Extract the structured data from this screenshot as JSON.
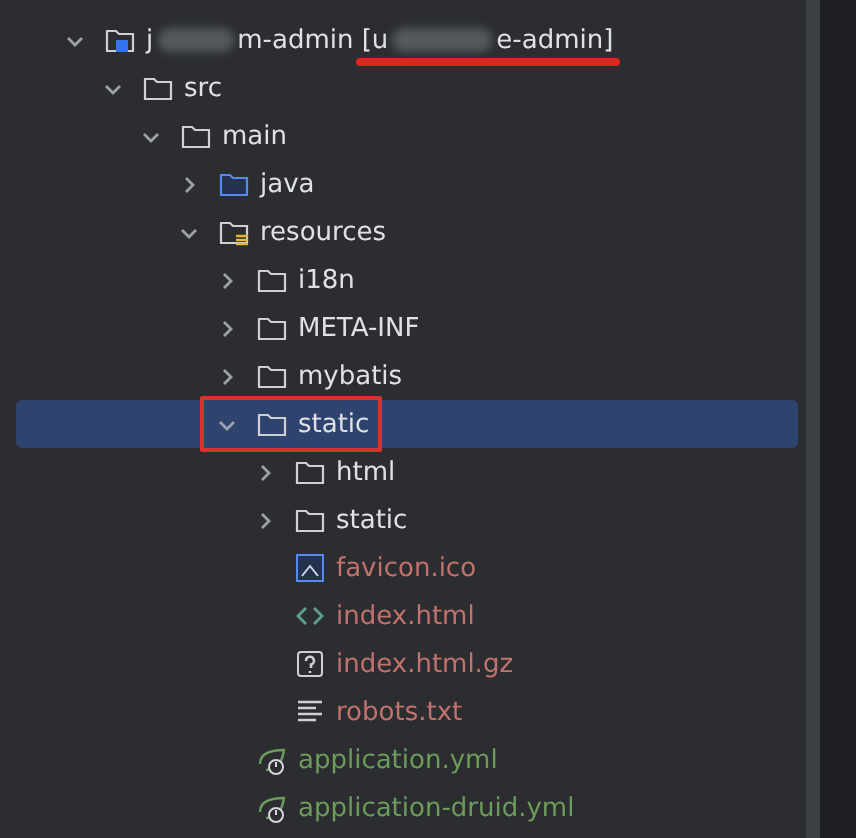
{
  "tree": [
    {
      "kind": "module",
      "name_parts": [
        "j",
        "m-admin"
      ],
      "module_parts": [
        "[u",
        "e-admin]"
      ],
      "module_underlined": true,
      "expanded": true,
      "selected": false,
      "children": [
        {
          "kind": "folder",
          "name": "src",
          "expanded": true,
          "selected": false,
          "children": [
            {
              "kind": "folder",
              "name": "main",
              "expanded": true,
              "selected": false,
              "children": [
                {
                  "kind": "source-folder",
                  "name": "java",
                  "expanded": false,
                  "selected": false
                },
                {
                  "kind": "resource-folder",
                  "name": "resources",
                  "expanded": true,
                  "selected": false,
                  "children": [
                    {
                      "kind": "folder",
                      "name": "i18n",
                      "expanded": false,
                      "selected": false
                    },
                    {
                      "kind": "folder",
                      "name": "META-INF",
                      "expanded": false,
                      "selected": false
                    },
                    {
                      "kind": "folder",
                      "name": "mybatis",
                      "expanded": false,
                      "selected": false
                    },
                    {
                      "kind": "folder",
                      "name": "static",
                      "expanded": true,
                      "selected": true,
                      "boxed": true,
                      "children": [
                        {
                          "kind": "folder",
                          "name": "html",
                          "expanded": false,
                          "selected": false
                        },
                        {
                          "kind": "folder",
                          "name": "static",
                          "expanded": false,
                          "selected": false
                        },
                        {
                          "kind": "image",
                          "name": "favicon.ico",
                          "selected": false,
                          "color": "#c2726d"
                        },
                        {
                          "kind": "html",
                          "name": "index.html",
                          "selected": false,
                          "color": "#c2726d"
                        },
                        {
                          "kind": "unknown",
                          "name": "index.html.gz",
                          "selected": false,
                          "color": "#c2726d"
                        },
                        {
                          "kind": "text",
                          "name": "robots.txt",
                          "selected": false,
                          "color": "#c2726d"
                        }
                      ]
                    },
                    {
                      "kind": "spring",
                      "name": "application.yml",
                      "selected": false,
                      "color": "#6c9b5a"
                    },
                    {
                      "kind": "spring",
                      "name": "application-druid.yml",
                      "selected": false,
                      "color": "#6c9b5a"
                    }
                  ]
                }
              ]
            }
          ]
        }
      ]
    }
  ]
}
